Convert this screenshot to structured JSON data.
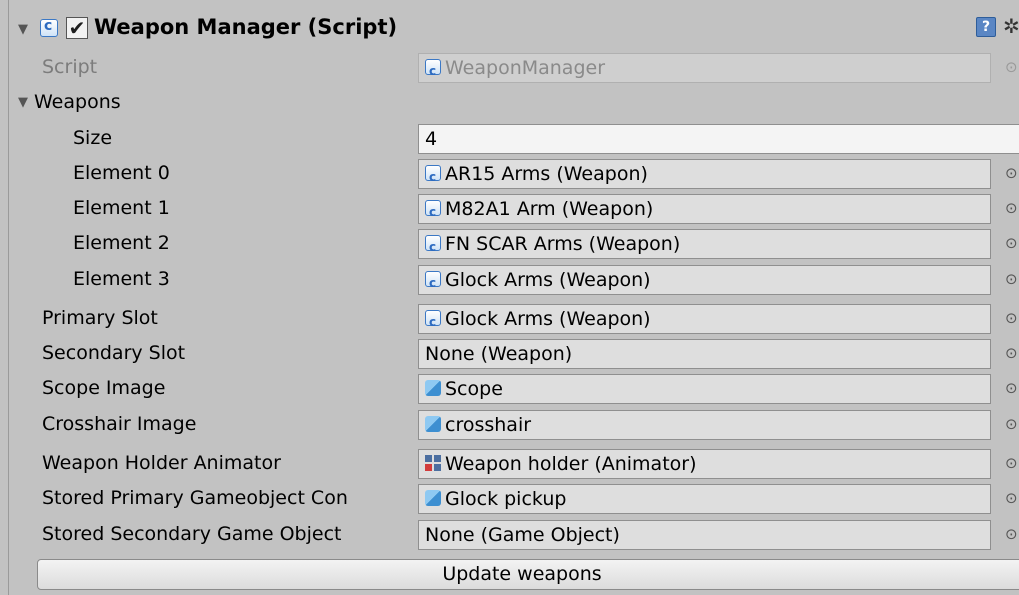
{
  "component": {
    "title": "Weapon Manager (Script)",
    "enabled_mark": "✔",
    "help_glyph": "?",
    "gear_glyph": "✲",
    "fold_open": "▼"
  },
  "script_row": {
    "label": "Script",
    "value": "WeaponManager"
  },
  "weapons": {
    "label": "Weapons",
    "size_label": "Size",
    "size_value": "4",
    "elements": [
      {
        "label": "Element 0",
        "value": "AR15 Arms (Weapon)"
      },
      {
        "label": "Element 1",
        "value": "M82A1 Arm (Weapon)"
      },
      {
        "label": "Element 2",
        "value": "FN SCAR Arms (Weapon)"
      },
      {
        "label": "Element 3",
        "value": "Glock Arms (Weapon)"
      }
    ]
  },
  "fields": [
    {
      "label": "Primary Slot",
      "value": "Glock Arms (Weapon)",
      "icon": "script-icon"
    },
    {
      "label": "Secondary Slot",
      "value": "None (Weapon)",
      "icon": ""
    },
    {
      "label": "Scope Image",
      "value": "Scope",
      "icon": "prefab-cube-icon"
    },
    {
      "label": "Crosshair Image",
      "value": "crosshair",
      "icon": "prefab-cube-icon"
    },
    {
      "label": "Weapon Holder Animator",
      "value": "Weapon holder (Animator)",
      "icon": "animator-icon"
    },
    {
      "label": "Stored Primary Gameobject Con",
      "value": "Glock pickup",
      "icon": "prefab-cube-icon"
    },
    {
      "label": "Stored Secondary Game Object",
      "value": "None (Game Object)",
      "icon": ""
    }
  ],
  "picker_glyph": "⊙",
  "update_button": "Update weapons"
}
